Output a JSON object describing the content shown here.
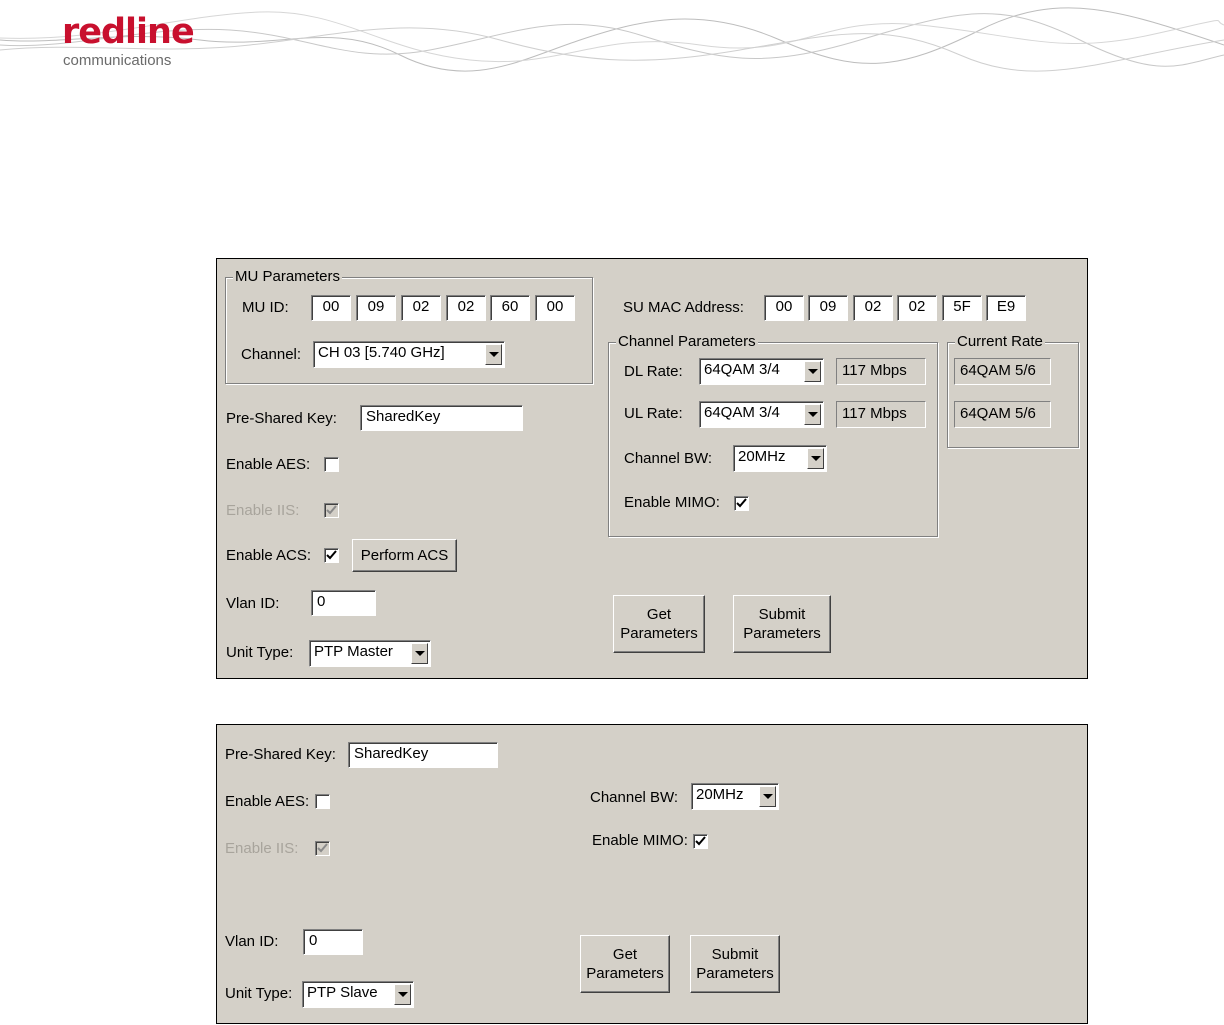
{
  "brand": {
    "name": "redline",
    "subtitle": "communications"
  },
  "master": {
    "mu_group_title": "MU Parameters",
    "mu_id_label": "MU ID:",
    "mu_id": [
      "00",
      "09",
      "02",
      "02",
      "60",
      "00"
    ],
    "channel_label": "Channel:",
    "channel_value": "CH 03 [5.740 GHz]",
    "psk_label": "Pre-Shared Key:",
    "psk_value": "SharedKey",
    "aes_label": "Enable AES:",
    "aes_checked": false,
    "iis_label": "Enable IIS:",
    "iis_checked": true,
    "acs_label": "Enable ACS:",
    "acs_checked": true,
    "perform_acs": "Perform ACS",
    "vlan_label": "Vlan ID:",
    "vlan_value": "0",
    "unit_label": "Unit Type:",
    "unit_value": "PTP Master",
    "su_mac_label": "SU MAC Address:",
    "su_mac": [
      "00",
      "09",
      "02",
      "02",
      "5F",
      "E9"
    ],
    "channel_params_title": "Channel Parameters",
    "dl_label": "DL Rate:",
    "dl_value": "64QAM 3/4",
    "dl_rate": "117 Mbps",
    "ul_label": "UL Rate:",
    "ul_value": "64QAM 3/4",
    "ul_rate": "117 Mbps",
    "bw_label": "Channel BW:",
    "bw_value": "20MHz",
    "mimo_label": "Enable MIMO:",
    "mimo_checked": true,
    "current_rate_title": "Current Rate",
    "current_dl": "64QAM 5/6",
    "current_ul": "64QAM 5/6",
    "get_btn": "Get\nParameters",
    "submit_btn": "Submit\nParameters"
  },
  "slave": {
    "psk_label": "Pre-Shared Key:",
    "psk_value": "SharedKey",
    "aes_label": "Enable AES:",
    "aes_checked": false,
    "iis_label": "Enable IIS:",
    "iis_checked": true,
    "bw_label": "Channel BW:",
    "bw_value": "20MHz",
    "mimo_label": "Enable MIMO:",
    "mimo_checked": true,
    "vlan_label": "Vlan ID:",
    "vlan_value": "0",
    "unit_label": "Unit Type:",
    "unit_value": "PTP Slave",
    "get_btn": "Get\nParameters",
    "submit_btn": "Submit\nParameters"
  },
  "colors": {
    "panel": "#d4d0c8",
    "brand_red": "#c8102e"
  }
}
